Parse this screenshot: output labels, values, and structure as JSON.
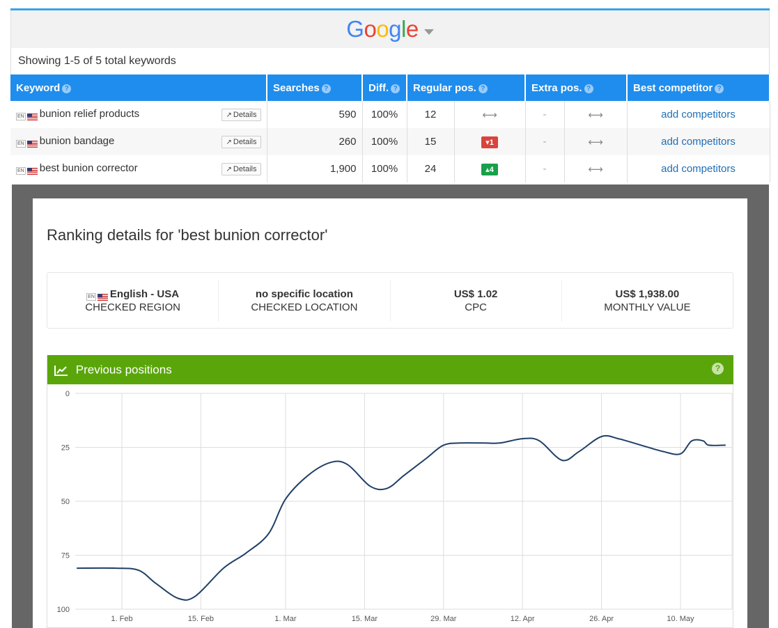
{
  "engine": {
    "name": "Google",
    "letters": [
      {
        "ch": "G",
        "color": "#4285F4"
      },
      {
        "ch": "o",
        "color": "#EA4335"
      },
      {
        "ch": "o",
        "color": "#FBBC05"
      },
      {
        "ch": "g",
        "color": "#4285F4"
      },
      {
        "ch": "l",
        "color": "#34A853"
      },
      {
        "ch": "e",
        "color": "#EA4335"
      }
    ]
  },
  "summary": "Showing 1-5 of 5 total keywords",
  "table": {
    "headers": {
      "keyword": "Keyword",
      "searches": "Searches",
      "diff": "Diff.",
      "regular": "Regular pos.",
      "extra": "Extra pos.",
      "best": "Best competitor"
    },
    "details_label": "Details",
    "lang_tag": "EN",
    "rows": [
      {
        "keyword": "bunion relief products",
        "searches": "590",
        "diff": "100%",
        "pos": "12",
        "change": "",
        "change_dir": "none",
        "extra": "-",
        "best": "add competitors"
      },
      {
        "keyword": "bunion bandage",
        "searches": "260",
        "diff": "100%",
        "pos": "15",
        "change": "1",
        "change_dir": "down",
        "extra": "-",
        "best": "add competitors"
      },
      {
        "keyword": "best bunion corrector",
        "searches": "1,900",
        "diff": "100%",
        "pos": "24",
        "change": "4",
        "change_dir": "up",
        "extra": "-",
        "best": "add competitors"
      }
    ]
  },
  "modal": {
    "title": "Ranking details for 'best bunion corrector'",
    "info": [
      {
        "value": "English - USA",
        "label": "CHECKED REGION",
        "flag": true
      },
      {
        "value": "no specific location",
        "label": "CHECKED LOCATION",
        "flag": false
      },
      {
        "value": "US$ 1.02",
        "label": "CPC",
        "flag": false
      },
      {
        "value": "US$ 1,938.00",
        "label": "MONTHLY VALUE",
        "flag": false
      }
    ],
    "chart_title": "Previous positions"
  },
  "colors": {
    "header_blue": "#1f8ded",
    "chart_green": "#5aa60a",
    "line": "#1f3f66",
    "overlay": "#666666"
  },
  "chart_data": {
    "type": "line",
    "title": "Previous positions",
    "y_reversed": true,
    "ylim": [
      0,
      100
    ],
    "y_ticks": [
      0,
      25,
      50,
      75,
      100
    ],
    "x_ticks": [
      "1. Feb",
      "15. Feb",
      "1. Mar",
      "15. Mar",
      "29. Mar",
      "12. Apr",
      "26. Apr",
      "10. May"
    ],
    "x_tick_dates": [
      "2024-02-01",
      "2024-02-15",
      "2024-03-01",
      "2024-03-15",
      "2024-03-29",
      "2024-04-12",
      "2024-04-26",
      "2024-05-10"
    ],
    "series": [
      {
        "name": "",
        "points": [
          [
            "2024-01-24",
            81
          ],
          [
            "2024-01-31",
            81
          ],
          [
            "2024-02-04",
            82
          ],
          [
            "2024-02-07",
            88
          ],
          [
            "2024-02-11",
            95
          ],
          [
            "2024-02-14",
            94
          ],
          [
            "2024-02-19",
            81
          ],
          [
            "2024-02-23",
            74
          ],
          [
            "2024-02-27",
            65
          ],
          [
            "2024-03-01",
            49
          ],
          [
            "2024-03-05",
            38
          ],
          [
            "2024-03-09",
            32
          ],
          [
            "2024-03-12",
            33
          ],
          [
            "2024-03-16",
            43
          ],
          [
            "2024-03-19",
            44
          ],
          [
            "2024-03-22",
            38
          ],
          [
            "2024-03-26",
            30
          ],
          [
            "2024-03-29",
            24
          ],
          [
            "2024-04-01",
            23
          ],
          [
            "2024-04-05",
            23
          ],
          [
            "2024-04-08",
            23
          ],
          [
            "2024-04-12",
            21
          ],
          [
            "2024-04-15",
            22
          ],
          [
            "2024-04-19",
            31
          ],
          [
            "2024-04-22",
            27
          ],
          [
            "2024-04-26",
            20
          ],
          [
            "2024-04-29",
            21
          ],
          [
            "2024-05-03",
            24
          ],
          [
            "2024-05-07",
            27
          ],
          [
            "2024-05-10",
            28
          ],
          [
            "2024-05-12",
            22
          ],
          [
            "2024-05-14",
            22
          ],
          [
            "2024-05-15",
            24
          ],
          [
            "2024-05-18",
            24
          ]
        ]
      }
    ]
  }
}
